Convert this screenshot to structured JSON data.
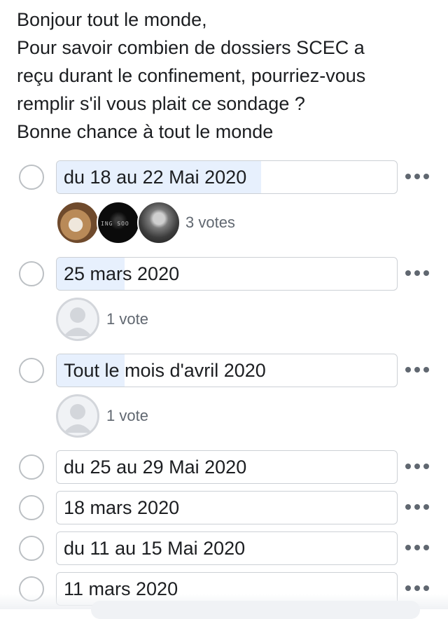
{
  "post": {
    "lines": [
      "Bonjour tout le monde,",
      "Pour savoir combien de dossiers SCEC a",
      "reçu durant le confinement, pourriez-vous",
      "remplir s'il vous plait ce sondage ?",
      "Bonne chance à tout le monde"
    ]
  },
  "poll": {
    "options": [
      {
        "label": "du 18 au 22 Mai 2020",
        "votes_text": "3 votes",
        "vote_share": 0.6
      },
      {
        "label": "25 mars 2020",
        "votes_text": "1 vote",
        "vote_share": 0.2
      },
      {
        "label": "Tout le mois d'avril 2020",
        "votes_text": "1 vote",
        "vote_share": 0.2
      },
      {
        "label": "du 25 au 29 Mai 2020",
        "votes_text": "",
        "vote_share": 0
      },
      {
        "label": "18 mars 2020",
        "votes_text": "",
        "vote_share": 0
      },
      {
        "label": "du 11 au 15 Mai 2020",
        "votes_text": "",
        "vote_share": 0
      },
      {
        "label": "11 mars 2020",
        "votes_text": "",
        "vote_share": 0
      }
    ],
    "voter_avatar_text": "ING SOO"
  },
  "colors": {
    "fill": "#e7f0fd",
    "border": "#ccd0d5",
    "muted_text": "#606770"
  },
  "icons": {
    "more": "three-dots-horizontal",
    "radio": "empty-circle",
    "default_avatar": "person-silhouette"
  }
}
